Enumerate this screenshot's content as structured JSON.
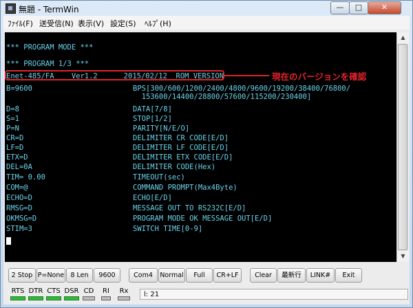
{
  "window": {
    "title": "無題 - TermWin",
    "min_label": "—",
    "max_label": "□",
    "close_label": "✕"
  },
  "menu": [
    {
      "label": "ﾌｧｲﾙ(F)"
    },
    {
      "label": "送受信(N)"
    },
    {
      "label": "表示(V)"
    },
    {
      "label": "設定(S)"
    },
    {
      "label": "ﾍﾙﾌﾟ(H)"
    }
  ],
  "terminal": {
    "lines": [
      {
        "left": "*** PROGRAM MODE ***",
        "right": ""
      },
      {
        "left": "*** PROGRAM 1/3 ***",
        "right": ""
      },
      {
        "left": "Enet-485/FA    Ver1.2      2015/02/12  ROM VERSION",
        "right": ""
      },
      {
        "left": "B=9600",
        "right": "BPS[300/600/1200/2400/4800/9600/19200/38400/76800/"
      },
      {
        "left": "",
        "right": "  153600/14400/28800/57600/115200/230400]"
      },
      {
        "left": "D=8",
        "right": "DATA[7/8]"
      },
      {
        "left": "S=1",
        "right": "STOP[1/2]"
      },
      {
        "left": "P=N",
        "right": "PARITY[N/E/O]"
      },
      {
        "left": "CR=D",
        "right": "DELIMITER CR CODE[E/D]"
      },
      {
        "left": "LF=D",
        "right": "DELIMITER LF CODE[E/D]"
      },
      {
        "left": "ETX=D",
        "right": "DELIMITER ETX CODE[E/D]"
      },
      {
        "left": "DEL=0A",
        "right": "DELIMITER CODE(Hex)"
      },
      {
        "left": "TIM= 0.00",
        "right": "TIMEOUT(sec)"
      },
      {
        "left": "COM=@",
        "right": "COMMAND PROMPT(Max4Byte)"
      },
      {
        "left": "ECHO=D",
        "right": "ECHO[E/D]"
      },
      {
        "left": "RMSG=D",
        "right": "MESSAGE OUT TO RS232C[E/D]"
      },
      {
        "left": "OKMSG=D",
        "right": "PROGRAM MODE OK MESSAGE OUT[E/D]"
      },
      {
        "left": "STIM=3",
        "right": "SWITCH TIME[0-9]"
      }
    ],
    "annotation": "現在のバージョンを確認",
    "text_color": "#6ad4ec",
    "annotation_color": "#e6242c"
  },
  "scrollbar": {
    "up_icon": "▲",
    "down_icon": "▼"
  },
  "toolbar": [
    {
      "label": "2 Stop"
    },
    {
      "label": "P=None"
    },
    {
      "label": "8 Len"
    },
    {
      "label": "9600"
    },
    {
      "label": "Com4"
    },
    {
      "label": "Normal"
    },
    {
      "label": "Full"
    },
    {
      "label": "CR+LF"
    },
    {
      "label": "Clear"
    },
    {
      "label": "最新行"
    },
    {
      "label": "LINK#"
    },
    {
      "label": "Exit"
    }
  ],
  "status": {
    "leds": [
      {
        "label": "RTS",
        "on": true
      },
      {
        "label": "DTR",
        "on": true
      },
      {
        "label": "CTS",
        "on": true
      },
      {
        "label": "DSR",
        "on": true
      },
      {
        "label": "CD",
        "on": false
      },
      {
        "label": "RI",
        "on": false
      },
      {
        "label": "Rx",
        "on": false
      }
    ],
    "info": "l: 21"
  }
}
